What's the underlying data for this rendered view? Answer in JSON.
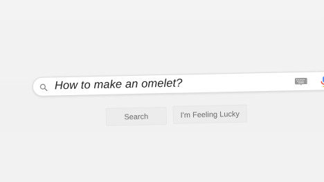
{
  "search": {
    "query": "How to make an omelet?",
    "icon": "search-icon"
  },
  "buttons": {
    "search_label": "Search",
    "lucky_label": "I'm Feeling Lucky"
  },
  "icons": {
    "keyboard": "keyboard-icon",
    "microphone": "microphone-icon"
  },
  "colors": {
    "background": "#f2f2f2",
    "search_bar": "#ffffff",
    "button_bg": "#ececec",
    "button_text": "#6a6a6a",
    "mic_blue": "#4285f4",
    "mic_red": "#ea4335"
  }
}
